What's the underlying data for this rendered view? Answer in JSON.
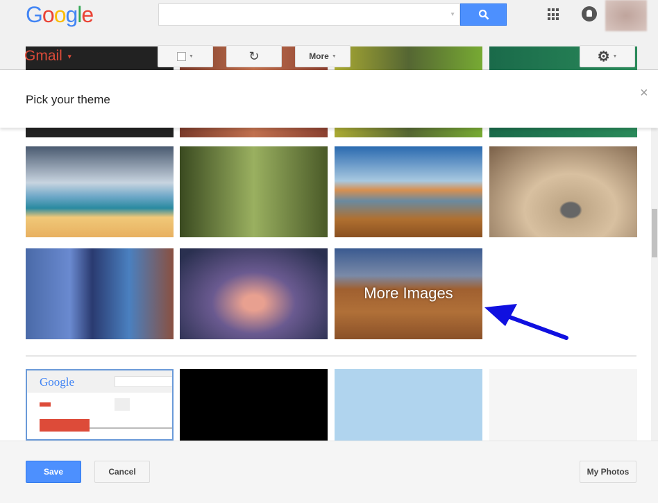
{
  "header": {
    "logo": "Google",
    "search": {
      "value": "",
      "placeholder": ""
    }
  },
  "toolbar": {
    "app_label": "Gmail",
    "more_label": "More"
  },
  "dialog": {
    "title": "Pick your theme",
    "close_label": "×",
    "more_images_label": "More Images",
    "footer": {
      "save_label": "Save",
      "cancel_label": "Cancel",
      "my_photos_label": "My Photos"
    }
  },
  "themes": [
    "bokeh",
    "autumn-leaves",
    "green-field",
    "green-grass",
    "beach",
    "forest",
    "golden-gate",
    "desert-rock",
    "city-buildings",
    "storm-sky",
    "more-images",
    "classic-default",
    "black",
    "light-blue",
    "light-gray"
  ],
  "colors": {
    "accent": "#4d90fe",
    "gmail_red": "#dd4b39",
    "annotation_arrow": "#1010e0"
  },
  "preview": {
    "logo": "Google"
  }
}
